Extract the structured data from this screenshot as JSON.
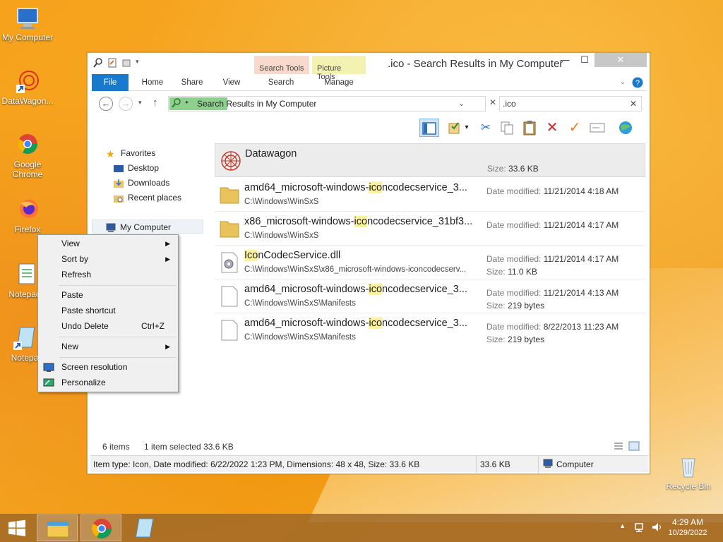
{
  "desktop": {
    "icons": [
      {
        "label": "My Computer"
      },
      {
        "label": "DataWagon..."
      },
      {
        "label": "Google Chrome"
      },
      {
        "label": "Firefox"
      },
      {
        "label": "Notepad"
      },
      {
        "label": "Notepa"
      },
      {
        "label": "Recycle Bin"
      }
    ]
  },
  "window": {
    "title": ".ico - Search Results in My Computer",
    "context_tabs": {
      "search_tools": "Search Tools",
      "picture_tools": "Picture Tools"
    },
    "ribbon_tabs": [
      "File",
      "Home",
      "Share",
      "View",
      "Search",
      "Manage"
    ],
    "address": "Search Results in My Computer",
    "search_value": ".ico",
    "nav": {
      "favorites": "Favorites",
      "desktop": "Desktop",
      "downloads": "Downloads",
      "recent": "Recent places",
      "my_computer": "My Computer"
    },
    "files": [
      {
        "name_pre": "Datawagon",
        "name_hl": "",
        "name_post": "",
        "path": "",
        "meta1_label": "",
        "meta1_value": "",
        "meta2_label": "Size:",
        "meta2_value": "33.6 KB"
      },
      {
        "name_pre": "amd64_microsoft-windows-",
        "name_hl": "ico",
        "name_post": "ncodecservice_3...",
        "path": "C:\\Windows\\WinSxS",
        "meta1_label": "Date modified:",
        "meta1_value": "11/21/2014 4:18 AM",
        "meta2_label": "",
        "meta2_value": ""
      },
      {
        "name_pre": "x86_microsoft-windows-",
        "name_hl": "ico",
        "name_post": "ncodecservice_31bf3...",
        "path": "C:\\Windows\\WinSxS",
        "meta1_label": "Date modified:",
        "meta1_value": "11/21/2014 4:17 AM",
        "meta2_label": "",
        "meta2_value": ""
      },
      {
        "name_pre": "",
        "name_hl": "Ico",
        "name_post": "nCodecService.dll",
        "path": "C:\\Windows\\WinSxS\\x86_microsoft-windows-iconcodecserv...",
        "meta1_label": "Date modified:",
        "meta1_value": "11/21/2014 4:17 AM",
        "meta2_label": "Size:",
        "meta2_value": "11.0 KB"
      },
      {
        "name_pre": "amd64_microsoft-windows-",
        "name_hl": "ico",
        "name_post": "ncodecservice_3...",
        "path": "C:\\Windows\\WinSxS\\Manifests",
        "meta1_label": "Date modified:",
        "meta1_value": "11/21/2014 4:13 AM",
        "meta2_label": "Size:",
        "meta2_value": "219 bytes"
      },
      {
        "name_pre": "amd64_microsoft-windows-",
        "name_hl": "ico",
        "name_post": "ncodecservice_3...",
        "path": "C:\\Windows\\WinSxS\\Manifests",
        "meta1_label": "Date modified:",
        "meta1_value": "8/22/2013 11:23 AM",
        "meta2_label": "Size:",
        "meta2_value": "219 bytes"
      }
    ],
    "status": {
      "items": "6 items",
      "selected": "1 item selected  33.6 KB",
      "details": "Item type: Icon, Date modified: 6/22/2022 1:23 PM, Dimensions: 48 x 48, Size: 33.6 KB",
      "size": "33.6 KB",
      "location": "Computer"
    }
  },
  "context_menu": {
    "view": "View",
    "sort_by": "Sort by",
    "refresh": "Refresh",
    "paste": "Paste",
    "paste_shortcut": "Paste shortcut",
    "undo_delete": "Undo Delete",
    "undo_shortcut": "Ctrl+Z",
    "new": "New",
    "screen_resolution": "Screen resolution",
    "personalize": "Personalize"
  },
  "taskbar": {
    "time": "4:29 AM",
    "date": "10/29/2022"
  },
  "colors": {
    "accent": "#1979ca",
    "highlight": "#fbf39a",
    "search_tools_bg": "#f9d9cc",
    "picture_tools_bg": "#f4f2b0"
  }
}
